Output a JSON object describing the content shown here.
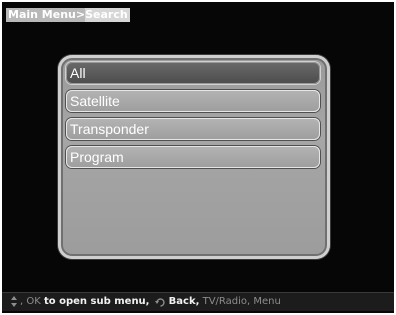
{
  "breadcrumb": {
    "root": "Main Menu",
    "separator": ">",
    "current": "Search"
  },
  "menu": {
    "items": [
      {
        "label": "All",
        "selected": true
      },
      {
        "label": "Satellite",
        "selected": false
      },
      {
        "label": "Transponder",
        "selected": false
      },
      {
        "label": "Program",
        "selected": false
      }
    ]
  },
  "footer": {
    "updown_icon": "up-down-arrows",
    "ok_prefix": ", OK",
    "ok_text": "to open sub menu,",
    "back_icon": "back-arrow",
    "back_text": "Back,",
    "tvradio_text": "TV/Radio,",
    "menu_text": "Menu"
  }
}
